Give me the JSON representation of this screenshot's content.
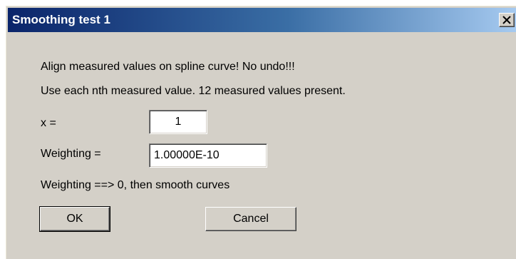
{
  "window": {
    "title": "Smoothing test 1",
    "close_icon": "close-icon"
  },
  "content": {
    "line1": "Align measured values on spline curve! No undo!!!",
    "line2": "Use each nth measured value. 12 measured values present.",
    "x_label": "x =",
    "x_value": "1",
    "weighting_label": "Weighting =",
    "weighting_value": "1.00000E-10",
    "hint": "Weighting ==> 0, then smooth curves"
  },
  "buttons": {
    "ok_label": "OK",
    "cancel_label": "Cancel"
  },
  "colors": {
    "titlebar_start": "#0a246a",
    "titlebar_end": "#a6caf0",
    "dialog_bg": "#d4d0c8"
  }
}
